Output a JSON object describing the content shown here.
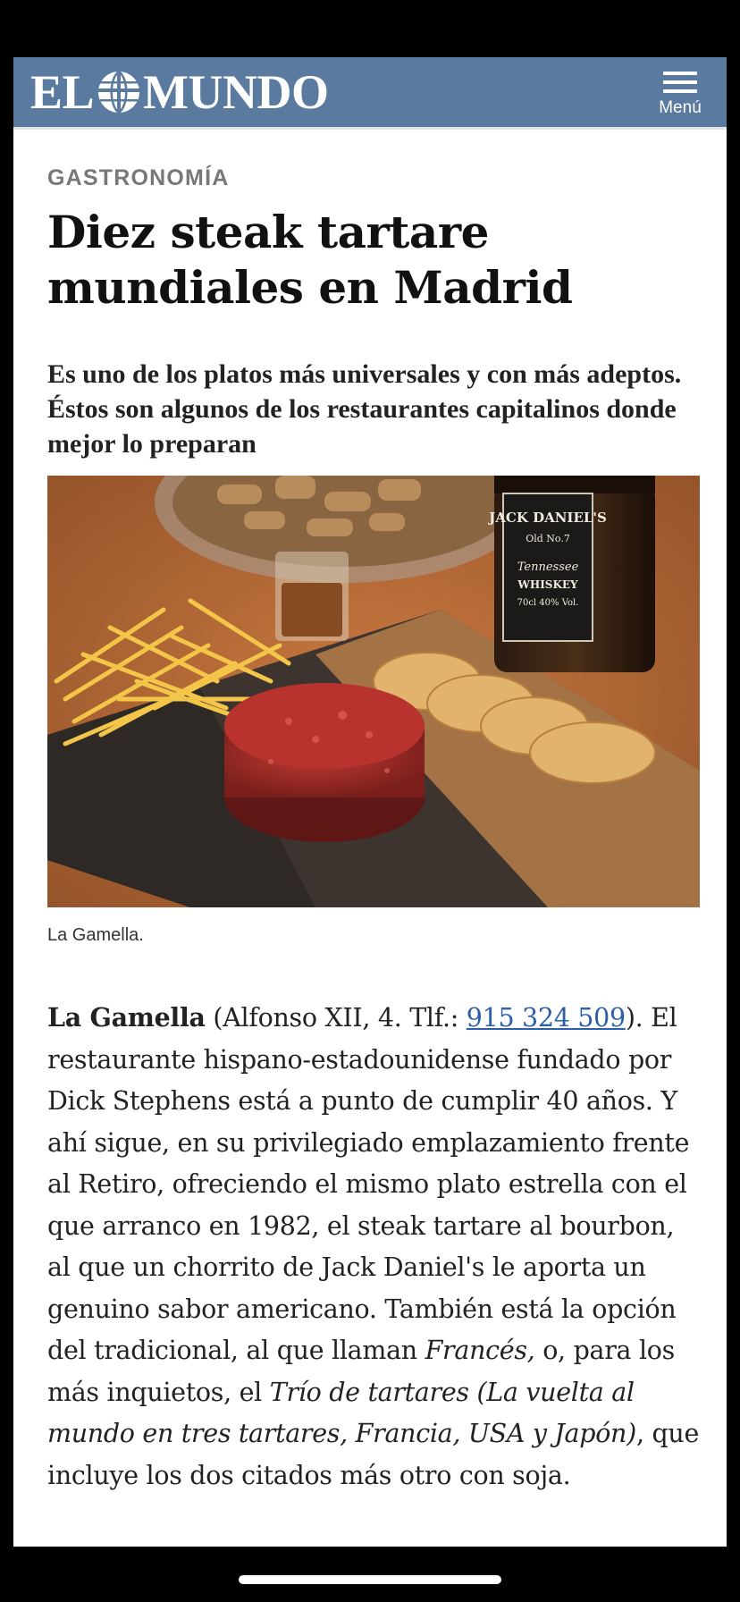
{
  "header": {
    "logo_text": "EL MUNDO",
    "logo_left": "EL",
    "logo_right": "MUNDO",
    "menu_label": "Menú"
  },
  "article": {
    "section": "GASTRONOMÍA",
    "title": "Diez steak tartare mundiales en Madrid",
    "subtitle": "Es uno de los platos más universales y con más adeptos. Éstos son algunos de los restaurantes capitalinos donde mejor lo preparan",
    "image_caption": "La Gamella.",
    "body": {
      "restaurant_name": "La Gamella",
      "address_open": " (Alfonso XII, 4. Tlf.: ",
      "phone": "915 324 509",
      "text_1": "). El restaurante hispano-estadounidense fundado por Dick Stephens está a punto de cumplir 40 años. Y ahí sigue, en su privilegiado emplazamiento frente al Retiro, ofreciendo el mismo plato estrella con el que arranco en 1982, el steak tartare al bourbon, al que un chorrito de Jack Daniel's le aporta un genuino sabor americano. También está la opción del tradicional, al que llaman ",
      "italic_1": "Francés,",
      "text_2": " o, para los más inquietos, el ",
      "italic_2": "Trío de tartares (La vuelta al mundo en tres tartares, Francia, USA y Japón)",
      "text_3": ", que incluye los dos citados más otro con soja."
    }
  },
  "photo": {
    "bottle_label_1": "JACK DANIEL'S",
    "bottle_label_2": "Old No.7",
    "bottle_label_3": "Tennessee",
    "bottle_label_4": "WHISKEY",
    "bottle_label_5": "70cl 40% Vol."
  },
  "colors": {
    "header_bg": "#5a7a9f",
    "section_gray": "#787878",
    "link_blue": "#2b5fa8"
  }
}
